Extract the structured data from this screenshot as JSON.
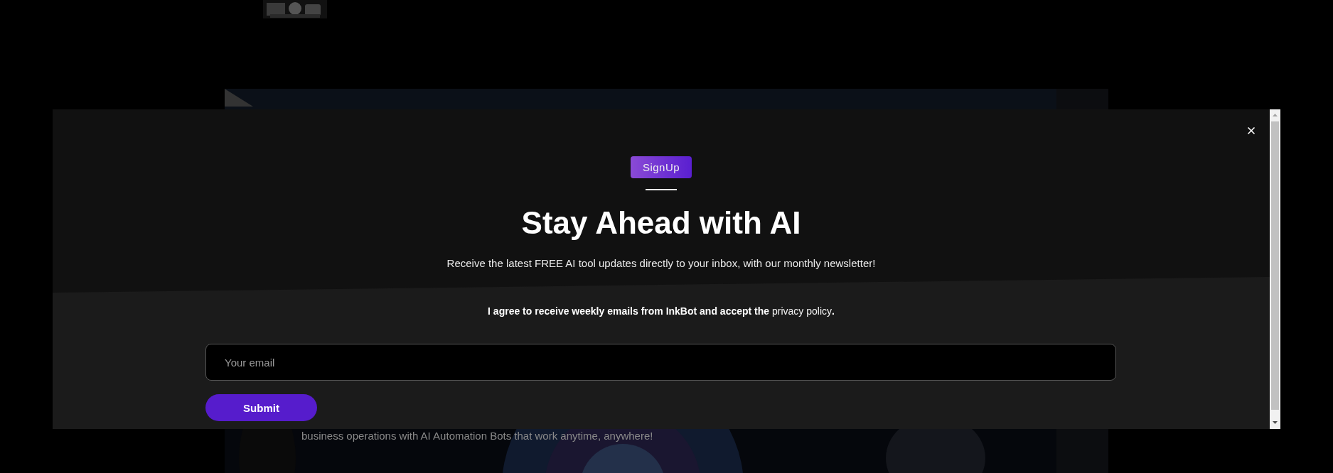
{
  "hero": {
    "kind": "picture",
    "text": "business operations with AI Automation Bots that work anytime, anywhere!"
  },
  "modal": {
    "badge": "SignUp",
    "title": "Stay Ahead with AI",
    "subtitle": "Receive the latest FREE AI tool updates directly to your inbox, with our monthly newsletter!",
    "consent": {
      "before": "I agree to receive weekly emails from InkBot and accept the ",
      "link": "privacy policy",
      "after": "."
    },
    "email": {
      "placeholder": "Your email"
    },
    "submit": "Submit"
  }
}
